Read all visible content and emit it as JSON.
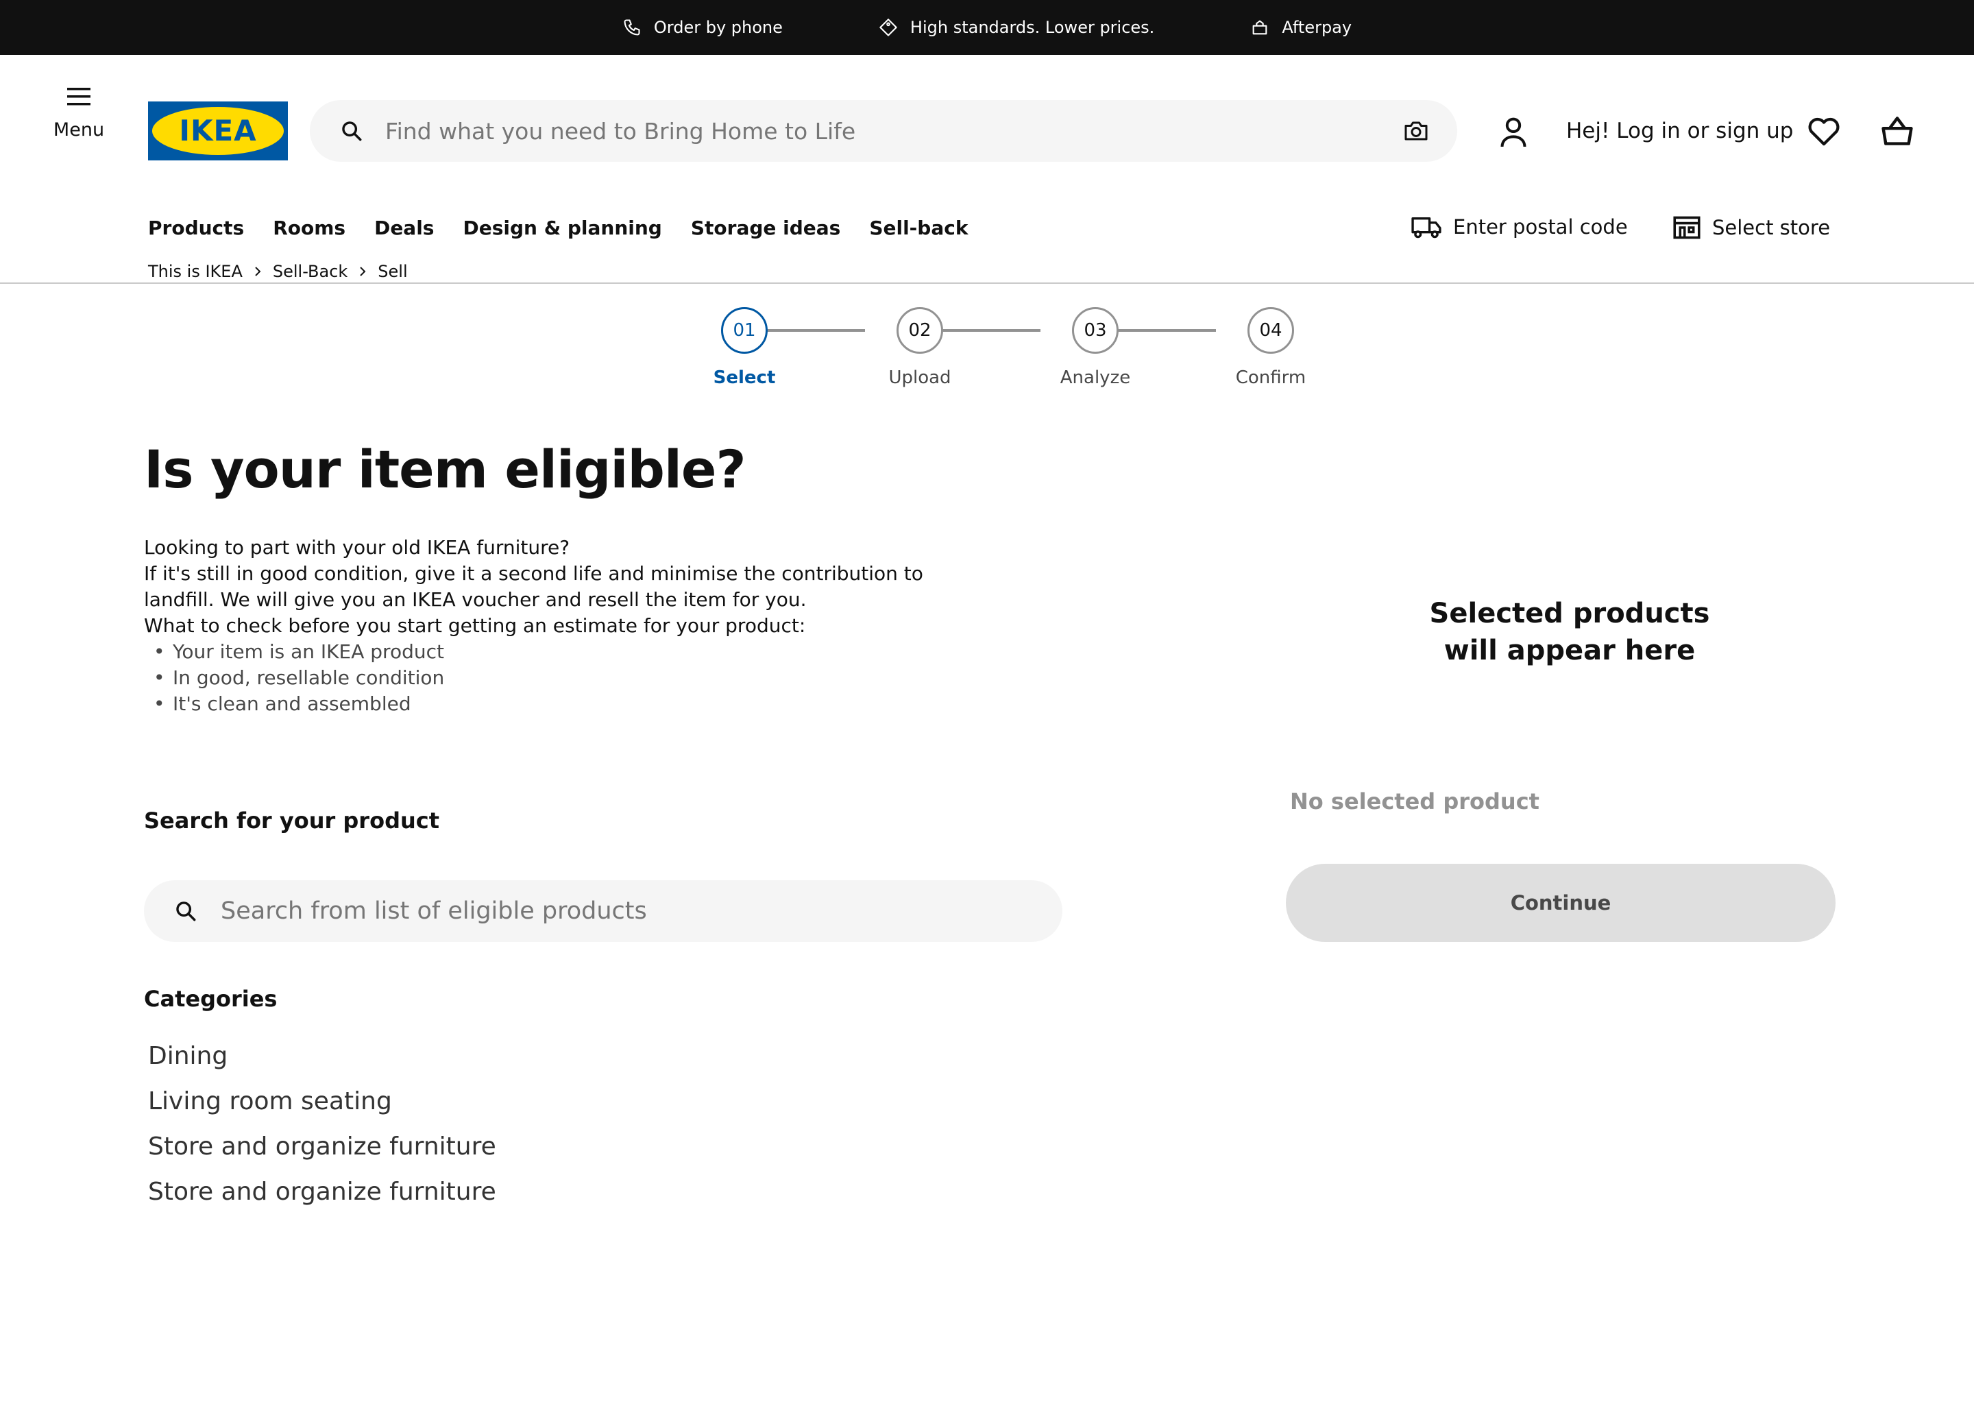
{
  "promo_bar": {
    "items": [
      {
        "label": "Order by phone",
        "icon": "phone-icon"
      },
      {
        "label": "High standards. Lower prices.",
        "icon": "price-tag-icon"
      },
      {
        "label": "Afterpay",
        "icon": "afterpay-icon"
      }
    ]
  },
  "header": {
    "menu_label": "Menu",
    "logo_text": "IKEA",
    "search_placeholder": "Find what you need to Bring Home to Life",
    "login_label": "Hej! Log in or sign up"
  },
  "nav": {
    "items": [
      "Products",
      "Rooms",
      "Deals",
      "Design & planning",
      "Storage ideas",
      "Sell-back"
    ],
    "postal_label": "Enter postal code",
    "store_label": "Select store"
  },
  "breadcrumb": [
    "This is IKEA",
    "Sell-Back",
    "Sell"
  ],
  "stepper": {
    "steps": [
      {
        "number": "01",
        "label": "Select",
        "active": true
      },
      {
        "number": "02",
        "label": "Upload",
        "active": false
      },
      {
        "number": "03",
        "label": "Analyze",
        "active": false
      },
      {
        "number": "04",
        "label": "Confirm",
        "active": false
      }
    ]
  },
  "main": {
    "heading": "Is your item eligible?",
    "intro_lines": [
      "Looking to part with your old IKEA furniture?",
      "If it's still in good condition, give it a second life and minimise the contribution to landfill. We will give you an IKEA voucher and resell the item for you.",
      "What to check before you start getting an estimate for your product:"
    ],
    "checklist": [
      "Your item is an IKEA product",
      "In good, resellable condition",
      "It's clean and assembled"
    ],
    "search_title": "Search for your product",
    "search_placeholder": "Search from list of eligible products",
    "categories_title": "Categories",
    "categories": [
      "Dining",
      "Living room seating",
      "Store and organize furniture",
      "Store and organize furniture"
    ]
  },
  "selection": {
    "title_line1": "Selected products",
    "title_line2": "will appear here",
    "empty_label": "No selected product",
    "continue_label": "Continue"
  },
  "colors": {
    "promo_bg": "#111111",
    "ikea_blue": "#0058a3",
    "ikea_yellow": "#ffdb00",
    "search_bg": "#f5f5f5",
    "disabled_button": "#dfdfdf"
  }
}
